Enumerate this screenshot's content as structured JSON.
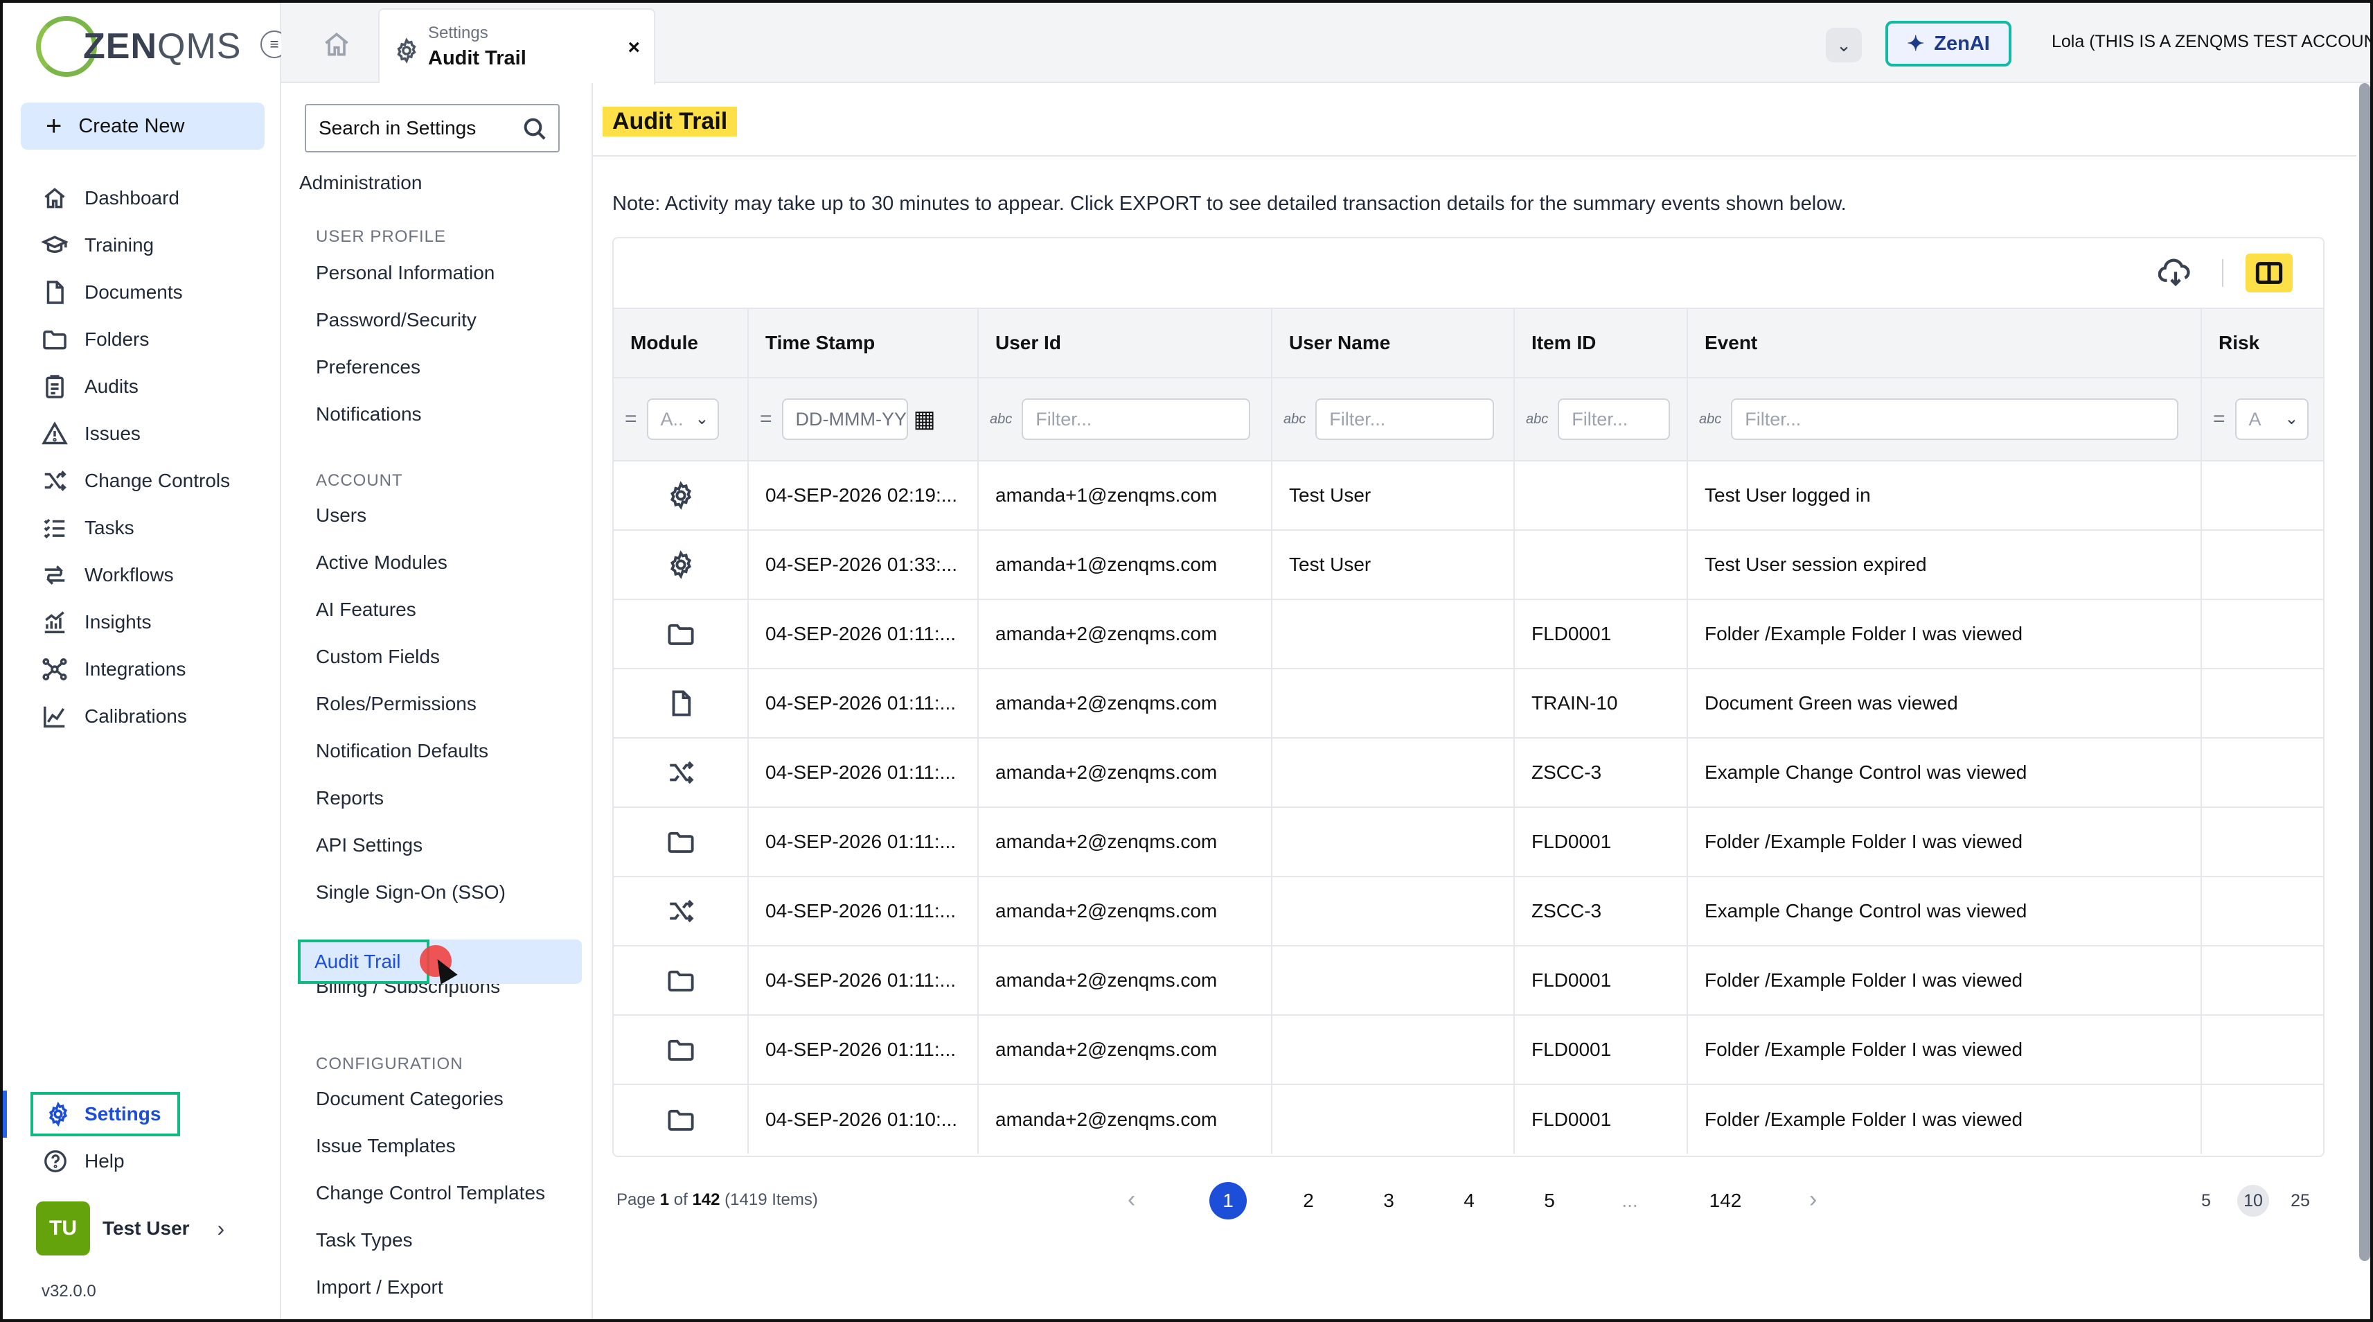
{
  "brand": {
    "logo_main": "ZEN",
    "logo_sub": "QMS"
  },
  "left_nav": {
    "create_new": "Create New",
    "items": [
      {
        "label": "Dashboard",
        "icon": "home-icon"
      },
      {
        "label": "Training",
        "icon": "graduation-cap-icon"
      },
      {
        "label": "Documents",
        "icon": "document-icon"
      },
      {
        "label": "Folders",
        "icon": "folder-icon"
      },
      {
        "label": "Audits",
        "icon": "clipboard-icon"
      },
      {
        "label": "Issues",
        "icon": "warning-icon"
      },
      {
        "label": "Change Controls",
        "icon": "shuffle-icon"
      },
      {
        "label": "Tasks",
        "icon": "checklist-icon"
      },
      {
        "label": "Workflows",
        "icon": "workflow-icon"
      },
      {
        "label": "Insights",
        "icon": "chart-icon"
      },
      {
        "label": "Integrations",
        "icon": "integrations-icon"
      },
      {
        "label": "Calibrations",
        "icon": "calibration-icon"
      }
    ],
    "settings": "Settings",
    "help": "Help",
    "user_initials": "TU",
    "user_name": "Test User",
    "version": "v32.0.0"
  },
  "topbar": {
    "tab_sub": "Settings",
    "tab_title": "Audit Trail",
    "tab_close": "×",
    "zenai": "ZenAI",
    "account": "Lola (THIS IS A ZENQMS TEST ACCOUNT)"
  },
  "settings_menu": {
    "search_placeholder": "Search in Settings",
    "admin": "Administration",
    "sections": [
      {
        "heading": "USER PROFILE",
        "items": [
          "Personal Information",
          "Password/Security",
          "Preferences",
          "Notifications"
        ]
      },
      {
        "heading": "ACCOUNT",
        "items": [
          "Users",
          "Active Modules",
          "AI Features",
          "Custom Fields",
          "Roles/Permissions",
          "Notification Defaults",
          "Reports",
          "API Settings",
          "Single Sign-On (SSO)",
          "Audit Trail",
          "Billing / Subscriptions"
        ]
      },
      {
        "heading": "CONFIGURATION",
        "items": [
          "Document Categories",
          "Issue Templates",
          "Change Control Templates",
          "Task Types",
          "Import / Export"
        ]
      }
    ]
  },
  "main": {
    "title": "Audit Trail",
    "note": "Note: Activity may take up to 30 minutes to appear. Click EXPORT to see detailed transaction details for the summary events shown below.",
    "columns": [
      "Module",
      "Time Stamp",
      "User Id",
      "User Name",
      "Item ID",
      "Event",
      "Risk"
    ],
    "filters": {
      "module": "A..",
      "timestamp": "DD-MMM-YY",
      "text": "Filter...",
      "risk": "A"
    },
    "rows": [
      {
        "icon": "gear-icon",
        "time": "04-SEP-2026 02:19:...",
        "user_id": "amanda+1@zenqms.com",
        "user_name": "Test User",
        "item_id": "",
        "event": "Test User logged in",
        "risk": ""
      },
      {
        "icon": "gear-icon",
        "time": "04-SEP-2026 01:33:...",
        "user_id": "amanda+1@zenqms.com",
        "user_name": "Test User",
        "item_id": "",
        "event": "Test User session expired",
        "risk": ""
      },
      {
        "icon": "folder-icon",
        "time": "04-SEP-2026 01:11:...",
        "user_id": "amanda+2@zenqms.com",
        "user_name": "",
        "item_id": "FLD0001",
        "event": "Folder /Example Folder I was viewed",
        "risk": ""
      },
      {
        "icon": "document-icon",
        "time": "04-SEP-2026 01:11:...",
        "user_id": "amanda+2@zenqms.com",
        "user_name": "",
        "item_id": "TRAIN-10",
        "event": "Document Green was viewed",
        "risk": ""
      },
      {
        "icon": "shuffle-icon",
        "time": "04-SEP-2026 01:11:...",
        "user_id": "amanda+2@zenqms.com",
        "user_name": "",
        "item_id": "ZSCC-3",
        "event": "Example Change Control was viewed",
        "risk": ""
      },
      {
        "icon": "folder-icon",
        "time": "04-SEP-2026 01:11:...",
        "user_id": "amanda+2@zenqms.com",
        "user_name": "",
        "item_id": "FLD0001",
        "event": "Folder /Example Folder I was viewed",
        "risk": ""
      },
      {
        "icon": "shuffle-icon",
        "time": "04-SEP-2026 01:11:...",
        "user_id": "amanda+2@zenqms.com",
        "user_name": "",
        "item_id": "ZSCC-3",
        "event": "Example Change Control was viewed",
        "risk": ""
      },
      {
        "icon": "folder-icon",
        "time": "04-SEP-2026 01:11:...",
        "user_id": "amanda+2@zenqms.com",
        "user_name": "",
        "item_id": "FLD0001",
        "event": "Folder /Example Folder I was viewed",
        "risk": ""
      },
      {
        "icon": "folder-icon",
        "time": "04-SEP-2026 01:11:...",
        "user_id": "amanda+2@zenqms.com",
        "user_name": "",
        "item_id": "FLD0001",
        "event": "Folder /Example Folder I was viewed",
        "risk": ""
      },
      {
        "icon": "folder-icon",
        "time": "04-SEP-2026 01:10:...",
        "user_id": "amanda+2@zenqms.com",
        "user_name": "",
        "item_id": "FLD0001",
        "event": "Folder /Example Folder I was viewed",
        "risk": ""
      }
    ]
  },
  "pagination": {
    "page_word": "Page",
    "current": "1",
    "of_word": "of",
    "total_pages": "142",
    "items_text": "(1419 Items)",
    "pages": [
      "1",
      "2",
      "3",
      "4",
      "5",
      "...",
      "142"
    ],
    "page_sizes": [
      "5",
      "10",
      "25"
    ],
    "active_size": "10"
  }
}
